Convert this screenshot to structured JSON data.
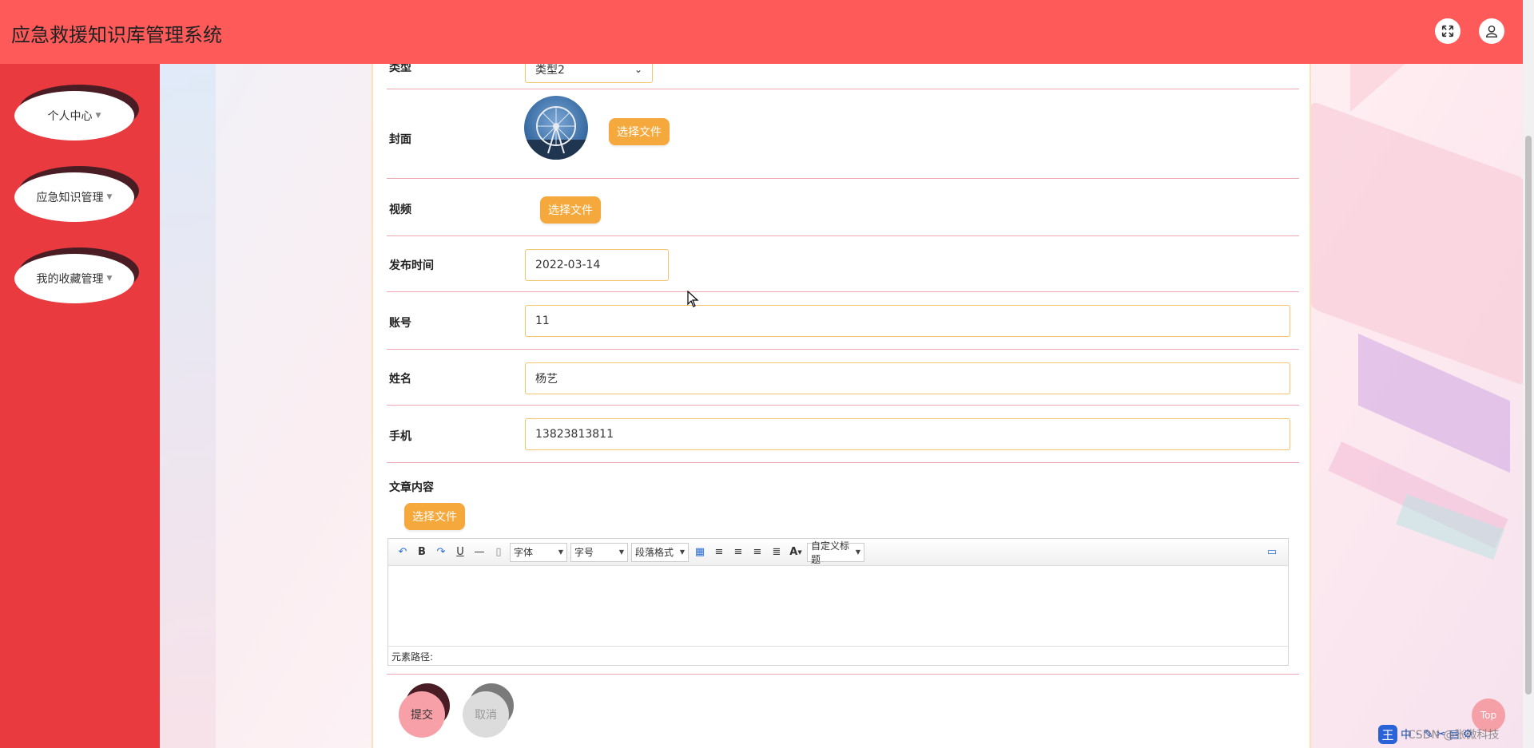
{
  "app": {
    "title": "应急救援知识库管理系统"
  },
  "header": {
    "fullscreen_icon": "expand-arrows-icon",
    "user_icon": "user-icon"
  },
  "sidebar": {
    "items": [
      {
        "label": "个人中心"
      },
      {
        "label": "应急知识管理"
      },
      {
        "label": "我的收藏管理"
      }
    ]
  },
  "form": {
    "type": {
      "label": "类型",
      "value": "类型2"
    },
    "cover": {
      "label": "封面",
      "button": "选择文件"
    },
    "video": {
      "label": "视频",
      "button": "选择文件"
    },
    "publish_time": {
      "label": "发布时间",
      "value": "2022-03-14"
    },
    "account": {
      "label": "账号",
      "value": "11"
    },
    "name": {
      "label": "姓名",
      "value": "杨艺"
    },
    "phone": {
      "label": "手机",
      "value": "13823813811"
    },
    "content": {
      "label": "文章内容",
      "button": "选择文件",
      "toolbar": {
        "font": "字体",
        "size": "字号",
        "paragraph": "段落格式",
        "custom_title": "自定义标题"
      },
      "element_path": "元素路径:"
    },
    "submit": "提交",
    "cancel": "取消"
  },
  "misc": {
    "top_button": "Top",
    "watermark": "CSDN @张微科技",
    "ime_label": "王",
    "ime_mode": "中"
  }
}
